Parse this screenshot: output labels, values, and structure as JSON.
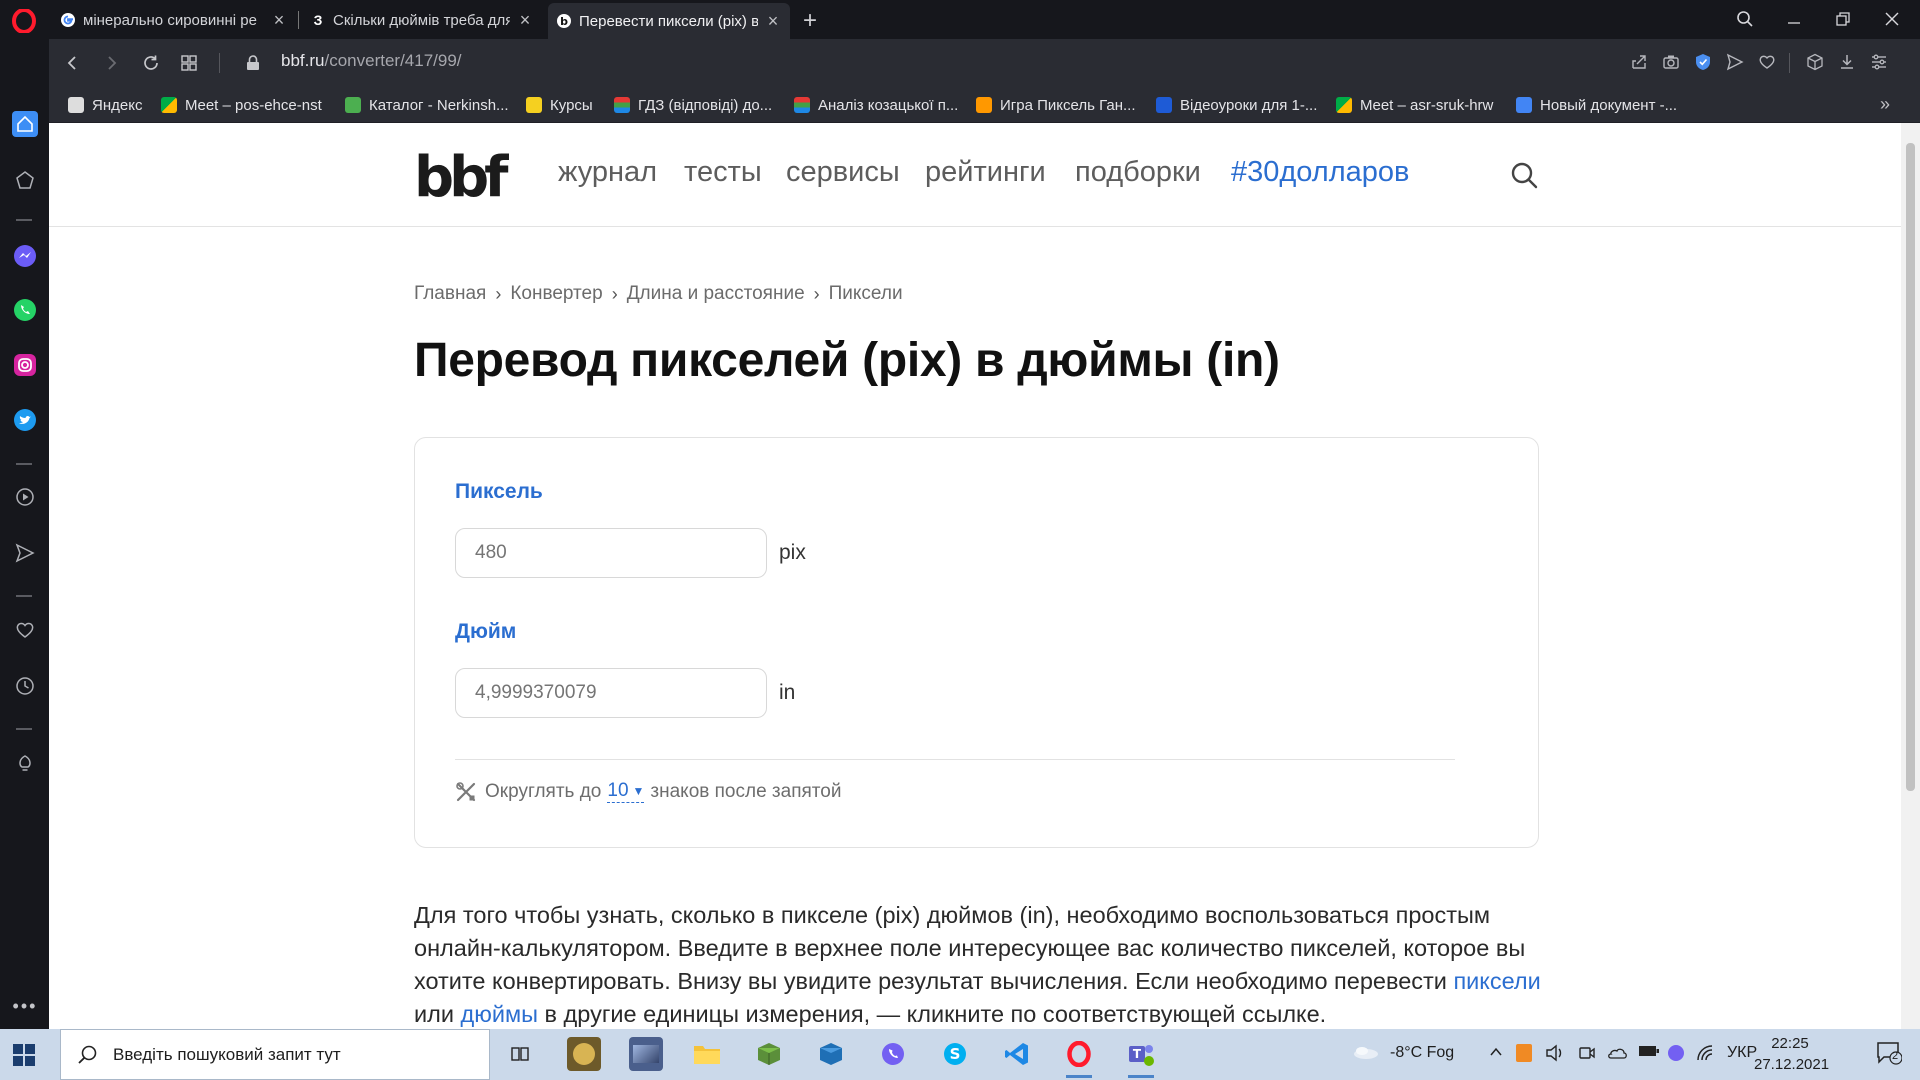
{
  "browser": {
    "tabs": [
      {
        "title": "мінерально сировинні ре",
        "favicon": "google-icon"
      },
      {
        "title": "Скільки дюймів треба для",
        "favicon": "z-icon"
      },
      {
        "title": "Перевести пиксели (pix) в",
        "favicon": "bbf-icon",
        "active": true
      }
    ],
    "url_host": "bbf.ru",
    "url_path": "/converter/417/99/",
    "bookmarks": [
      "Яндекс",
      "Meet – pos-ehce-nst",
      "Каталог - Nerkinsh...",
      "Курсы",
      "ГДЗ (відповіді) до...",
      "Аналіз козацької п...",
      "Игра Пиксель Ган...",
      "Відеоуроки для 1-...",
      "Meet – asr-sruk-hrw",
      "Новый документ -..."
    ],
    "accent_color": "#ff1b2d"
  },
  "site": {
    "logo": "bbf",
    "nav": [
      "журнал",
      "тесты",
      "сервисы",
      "рейтинги",
      "подборки",
      "#30долларов"
    ],
    "breadcrumbs": [
      "Главная",
      "Конвертер",
      "Длина и расстояние",
      "Пиксели"
    ],
    "title": "Перевод пикселей (pix) в дюймы (in)",
    "accent_color": "#2b6ed0"
  },
  "converter": {
    "from_label": "Пиксель",
    "from_placeholder": "480",
    "from_unit": "pix",
    "to_label": "Дюйм",
    "to_placeholder": "4,9999370079",
    "to_unit": "in",
    "round_prefix": "Округлять до",
    "round_value": "10",
    "round_suffix": "знаков после запятой"
  },
  "description": {
    "text_1": "Для того чтобы узнать, сколько в пикселе (pix) дюймов (in), необходимо воспользоваться простым онлайн-калькулятором. Введите в верхнее поле интересующее вас количество пикселей, которое вы хотите конвертировать. Внизу вы увидите результат вычисления. Если необходимо перевести",
    "link_1": "пиксели",
    "text_2": "или",
    "link_2": "дюймы",
    "text_3": "в другие единицы измерения, — кликните по соответствующей ссылке."
  },
  "taskbar": {
    "search_placeholder": "Введіть пошуковий запит тут",
    "weather": "-8°C  Fog",
    "language": "УКР",
    "time": "22:25",
    "date": "27.12.2021",
    "notification_count": "2"
  }
}
